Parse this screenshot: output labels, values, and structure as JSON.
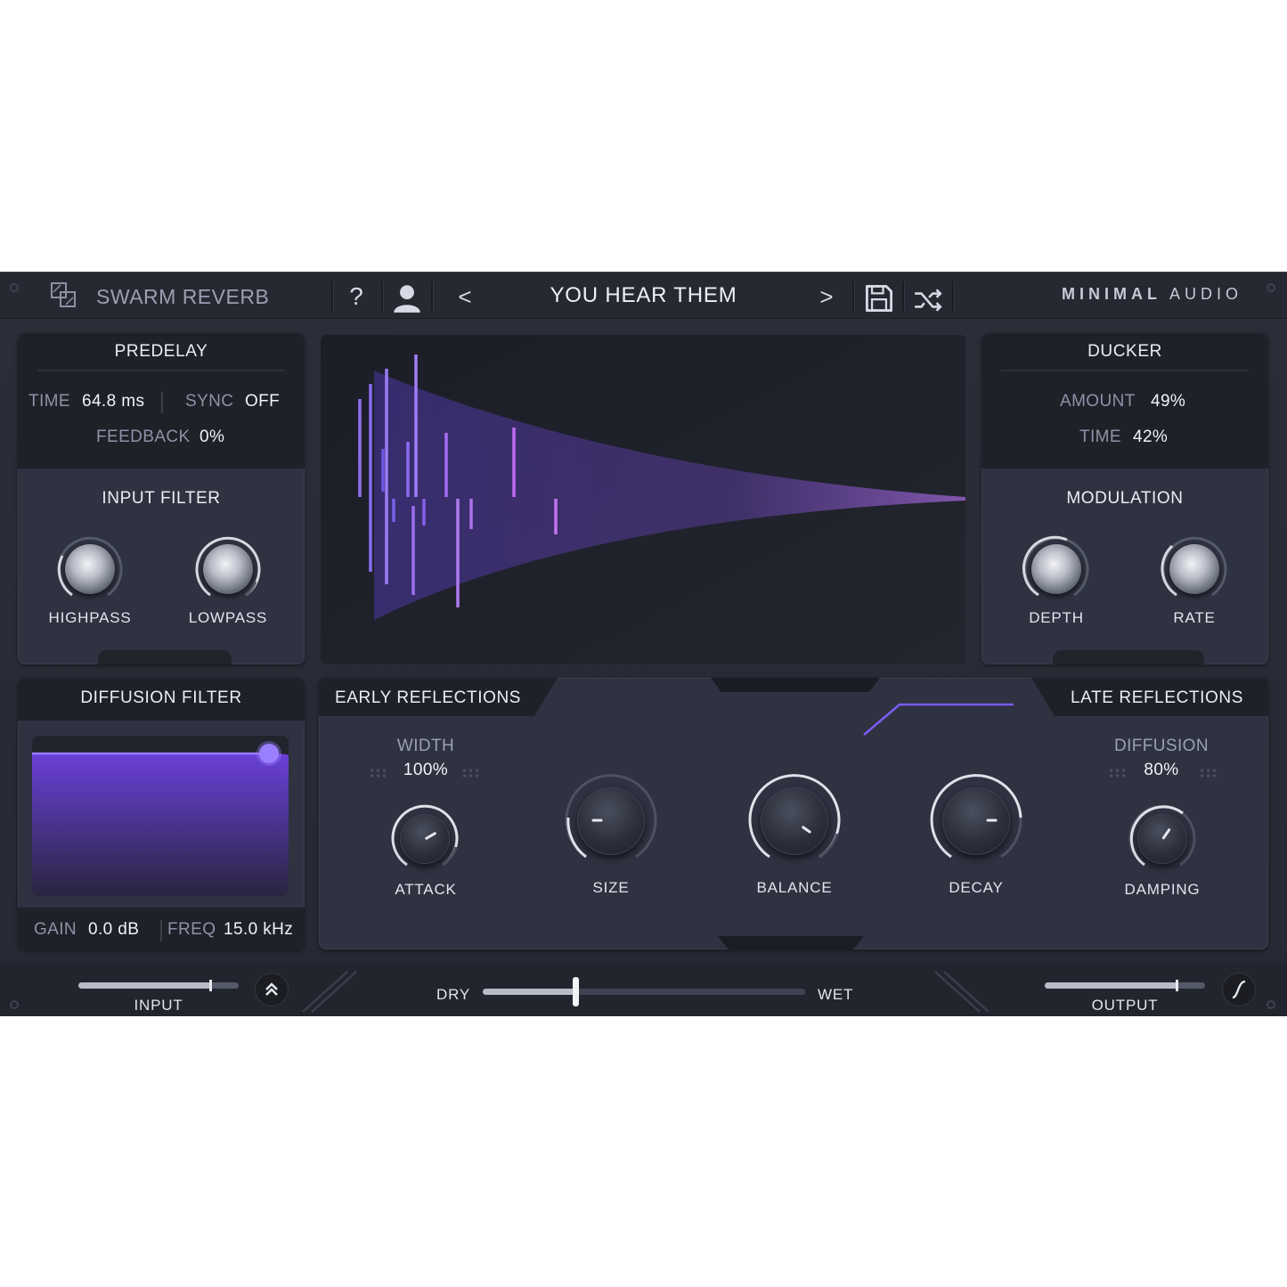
{
  "header": {
    "plugin_name": "SWARM REVERB",
    "help_glyph": "?",
    "prev_glyph": "<",
    "next_glyph": ">",
    "preset_name": "YOU HEAR THEM",
    "brand_bold": "MINIMAL",
    "brand_light": "AUDIO",
    "icons": [
      "logo-icon",
      "help-icon",
      "user-icon",
      "chevron-left-icon",
      "chevron-right-icon",
      "save-icon",
      "shuffle-icon"
    ]
  },
  "predelay": {
    "title": "PREDELAY",
    "time_label": "TIME",
    "time_value": "64.8 ms",
    "sync_label": "SYNC",
    "sync_value": "OFF",
    "feedback_label": "FEEDBACK",
    "feedback_value": "0%"
  },
  "input_filter": {
    "title": "INPUT FILTER",
    "highpass_label": "HIGHPASS",
    "lowpass_label": "LOWPASS"
  },
  "ducker": {
    "title": "DUCKER",
    "amount_label": "AMOUNT",
    "amount_value": "49%",
    "time_label": "TIME",
    "time_value": "42%"
  },
  "modulation": {
    "title": "MODULATION",
    "depth_label": "DEPTH",
    "rate_label": "RATE"
  },
  "diffusion_filter": {
    "title": "DIFFUSION FILTER",
    "gain_label": "GAIN",
    "gain_value": "0.0 dB",
    "freq_label": "FREQ",
    "freq_value": "15.0 kHz"
  },
  "early_reflections": {
    "title": "EARLY REFLECTIONS",
    "width_label": "WIDTH",
    "width_value": "100%",
    "attack_label": "ATTACK"
  },
  "late_reflections": {
    "title": "LATE REFLECTIONS",
    "diffusion_label": "DIFFUSION",
    "diffusion_value": "80%",
    "damping_label": "DAMPING"
  },
  "center_knobs": {
    "size_label": "SIZE",
    "balance_label": "BALANCE",
    "decay_label": "DECAY"
  },
  "footer": {
    "input_label": "INPUT",
    "output_label": "OUTPUT",
    "dry_label": "DRY",
    "wet_label": "WET",
    "dry_wet_mix": 0.29,
    "input_level": 0.83,
    "output_level": 0.83
  },
  "colors": {
    "accent": "#8a63f0",
    "panel": "#2f3240",
    "background": "#262932"
  }
}
